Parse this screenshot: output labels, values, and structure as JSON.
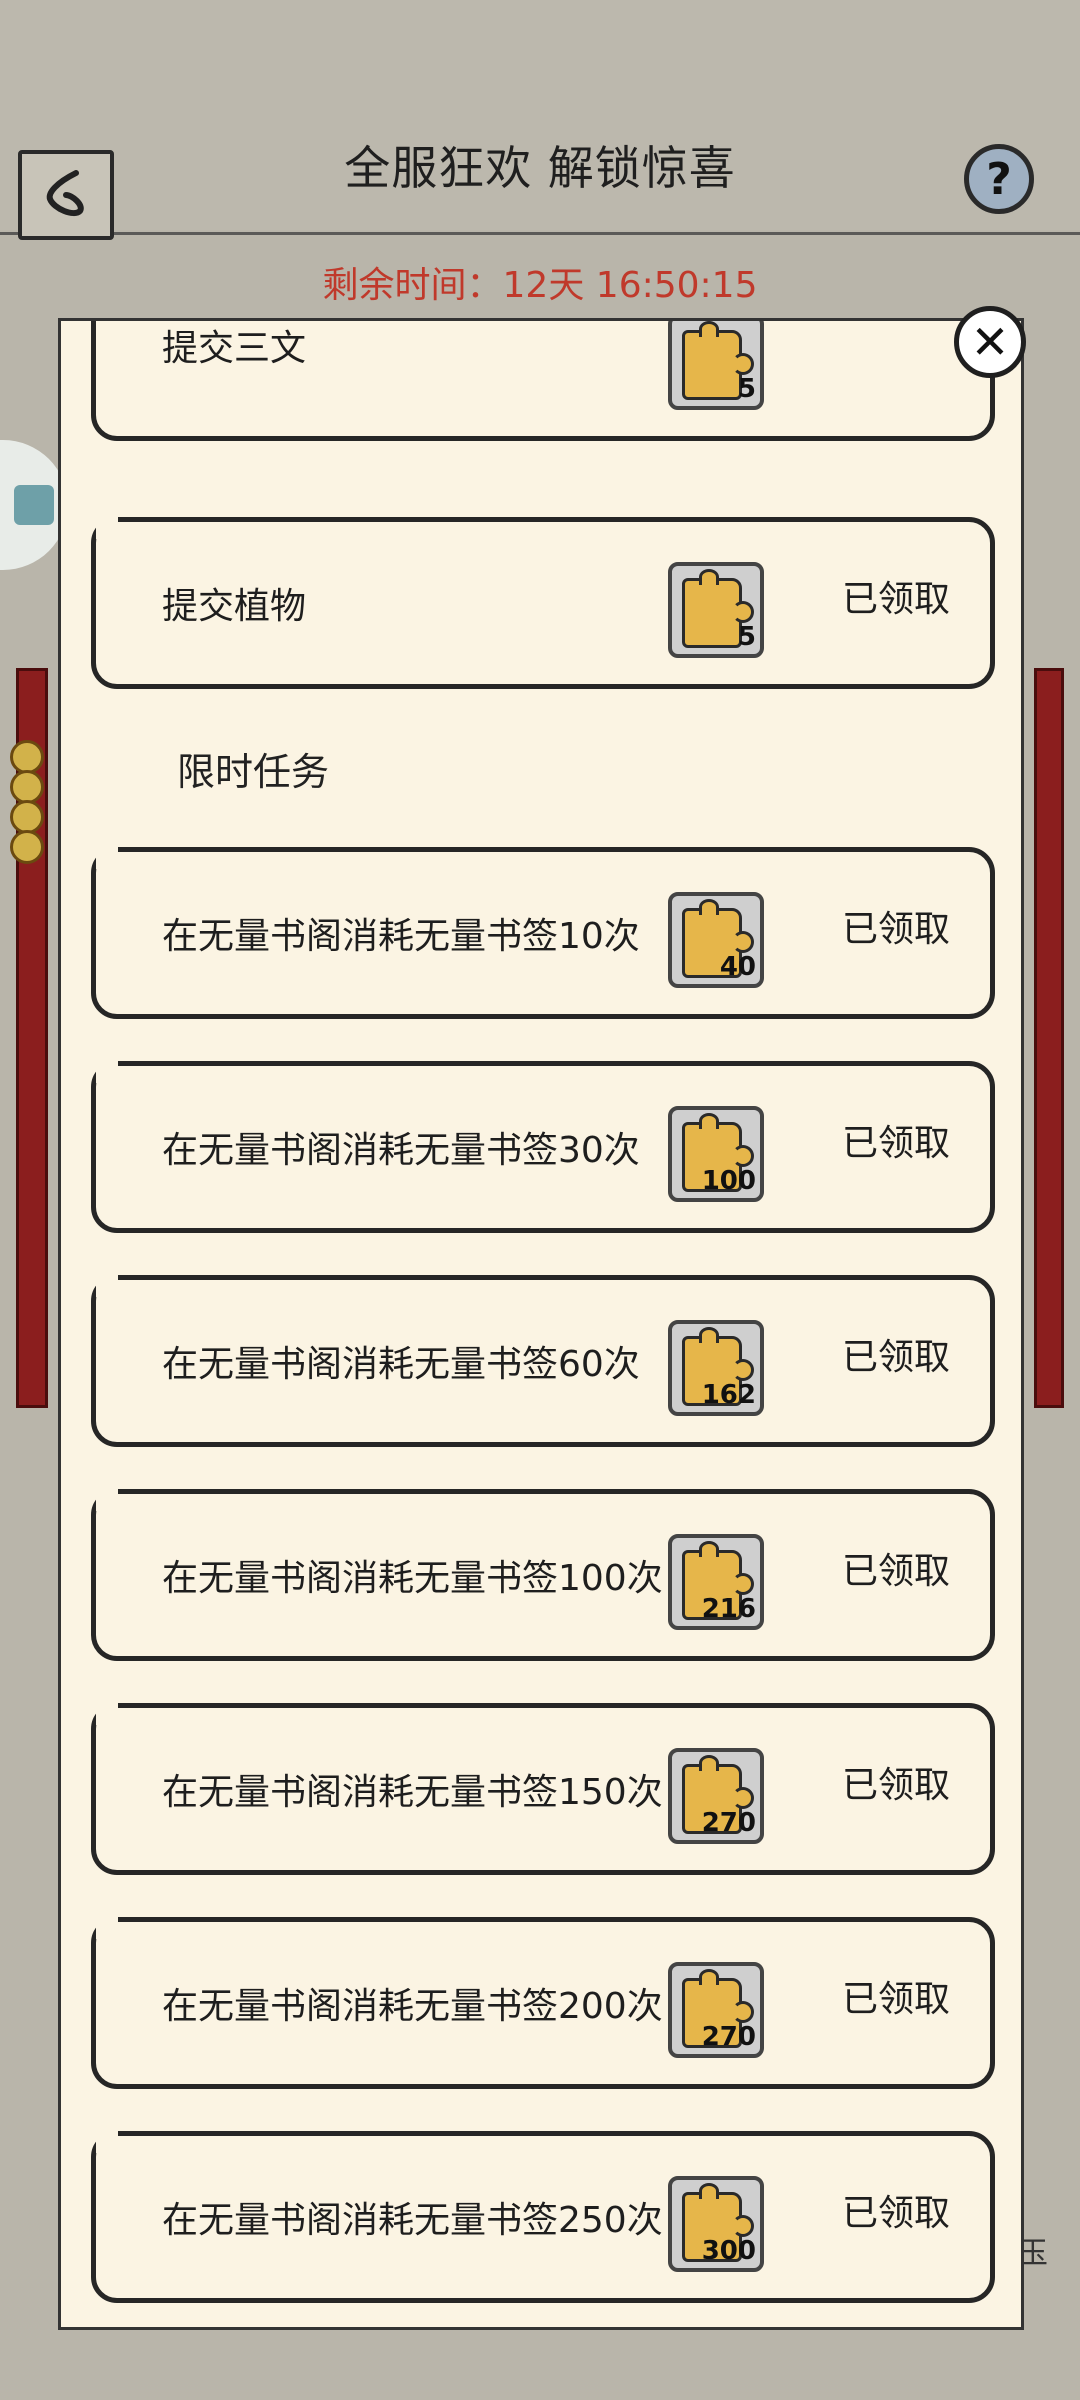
{
  "header": {
    "title": "全服狂欢 解锁惊喜",
    "help_label": "?",
    "timer": "剩余时间：12天 16:50:15"
  },
  "close_label": "✕",
  "section_title": "限时任务",
  "top_partial_card": {
    "label": "提交三文",
    "qty": "5"
  },
  "cards": [
    {
      "label": "提交植物",
      "qty": "5",
      "status": "已领取"
    },
    {
      "label": "在无量书阁消耗无量书签10次",
      "qty": "40",
      "status": "已领取"
    },
    {
      "label": "在无量书阁消耗无量书签30次",
      "qty": "100",
      "status": "已领取"
    },
    {
      "label": "在无量书阁消耗无量书签60次",
      "qty": "162",
      "status": "已领取"
    },
    {
      "label": "在无量书阁消耗无量书签100次",
      "qty": "216",
      "status": "已领取"
    },
    {
      "label": "在无量书阁消耗无量书签150次",
      "qty": "270",
      "status": "已领取"
    },
    {
      "label": "在无量书阁消耗无量书签200次",
      "qty": "270",
      "status": "已领取"
    },
    {
      "label": "在无量书阁消耗无量书签250次",
      "qty": "300",
      "status": "已领取"
    }
  ],
  "background_glyph": "玉",
  "colors": {
    "timer": "#c0392b",
    "panel": "#fbf4e3",
    "reward_piece": "#e6b64a",
    "scroll": "#8b1e1e"
  }
}
